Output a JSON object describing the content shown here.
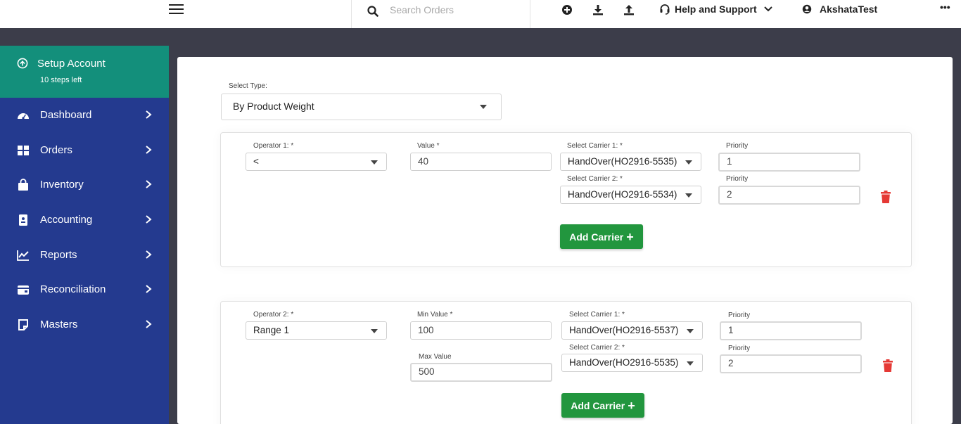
{
  "topbar": {
    "search_placeholder": "Search Orders",
    "help_label": "Help and Support",
    "user_name": "AkshataTest",
    "more_label": "•••"
  },
  "sidebar": {
    "setup_title": "Setup Account",
    "setup_sub": "10 steps left",
    "items": [
      {
        "label": "Dashboard",
        "icon": "speedometer-icon"
      },
      {
        "label": "Orders",
        "icon": "grid-icon"
      },
      {
        "label": "Inventory",
        "icon": "shopping-bag-icon"
      },
      {
        "label": "Accounting",
        "icon": "ledger-icon"
      },
      {
        "label": "Reports",
        "icon": "line-chart-icon"
      },
      {
        "label": "Reconciliation",
        "icon": "wallet-icon"
      },
      {
        "label": "Masters",
        "icon": "note-icon"
      }
    ]
  },
  "form": {
    "type_label": "Select Type:",
    "type_value": "By Product Weight",
    "add_carrier_label": "Add Carrier",
    "rule1": {
      "operator_label": "Operator 1: *",
      "operator_value": "<",
      "value_label": "Value *",
      "value": "40",
      "carrier1_label": "Select Carrier 1: *",
      "carrier1_value": "HandOver(HO2916-5535)",
      "priority1_label": "Priority",
      "priority1_value": "1",
      "carrier2_label": "Select Carrier 2: *",
      "carrier2_value": "HandOver(HO2916-5534)",
      "priority2_label": "Priority",
      "priority2_value": "2"
    },
    "rule2": {
      "operator_label": "Operator 2: *",
      "operator_value": "Range 1",
      "min_label": "Min Value *",
      "min_value": "100",
      "max_label": "Max Value",
      "max_value": "500",
      "carrier1_label": "Select Carrier 1: *",
      "carrier1_value": "HandOver(HO2916-5537)",
      "priority1_label": "Priority",
      "priority1_value": "1",
      "carrier2_label": "Select Carrier 2: *",
      "carrier2_value": "HandOver(HO2916-5535)",
      "priority2_label": "Priority",
      "priority2_value": "2"
    }
  },
  "colors": {
    "sidebar": "#243a8f",
    "setup": "#138f7b",
    "add_button": "#22963e",
    "trash": "#e53935"
  }
}
